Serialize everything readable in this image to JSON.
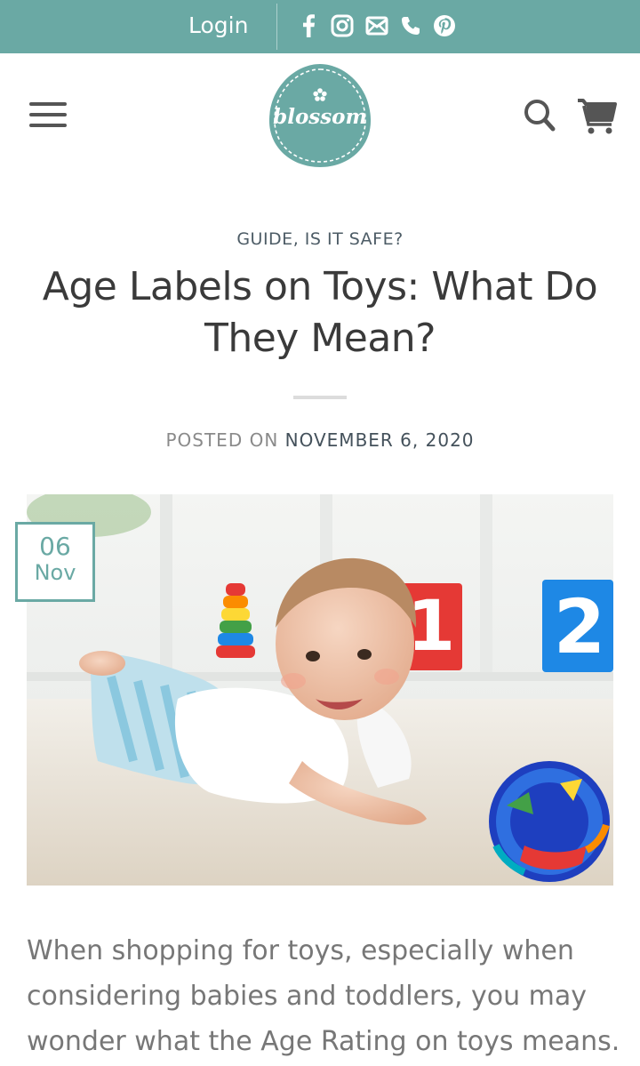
{
  "topbar": {
    "login_label": "Login",
    "social_icons": [
      "facebook-icon",
      "instagram-icon",
      "envelope-icon",
      "phone-icon",
      "pinterest-icon"
    ],
    "bg_color": "#6aa9a4"
  },
  "header": {
    "logo_text": "blossom",
    "menu_icon": "hamburger-icon",
    "search_icon": "search-icon",
    "cart_icon": "cart-icon"
  },
  "post": {
    "categories": [
      "GUIDE",
      "IS IT SAFE?"
    ],
    "category_separator": ", ",
    "title": "Age Labels on Toys: What Do They Mean?",
    "posted_prefix": "POSTED ON ",
    "posted_date": "NOVEMBER 6, 2020",
    "badge_day": "06",
    "badge_month": "Nov",
    "body": "When shopping for toys, especially when considering babies and toddlers, you may wonder what the Age Rating on toys means."
  },
  "colors": {
    "accent": "#6aa9a4",
    "title": "#3a3a3a",
    "body": "#777777"
  }
}
